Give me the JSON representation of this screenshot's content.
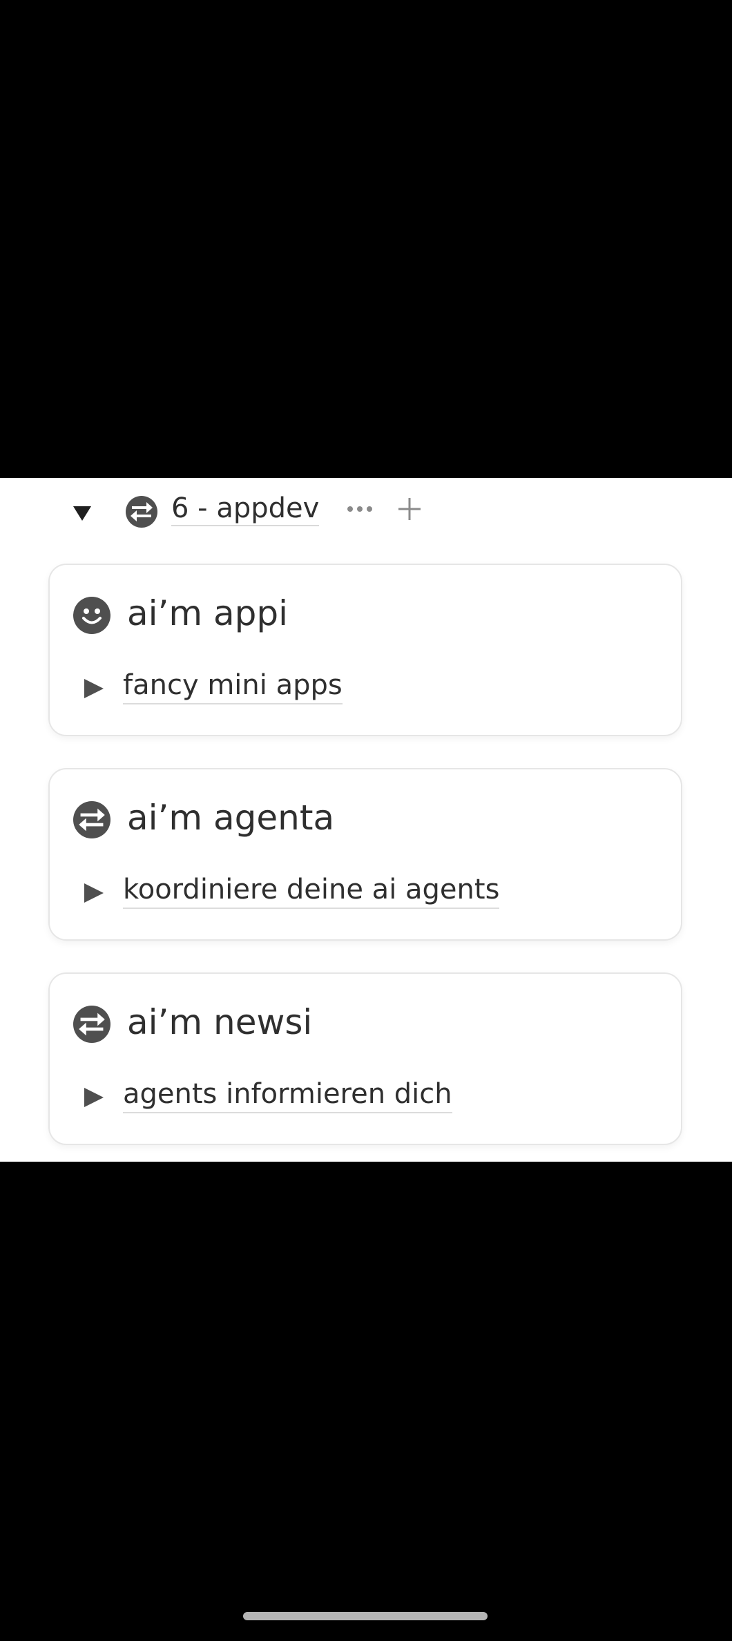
{
  "group": {
    "title": "6 - appdev",
    "toggle_icon": "caret-down-icon",
    "icon": "exchange-icon",
    "more_icon": "more-horizontal-icon",
    "add_icon": "plus-icon"
  },
  "cards": [
    {
      "title": "ai’m appi",
      "icon": "smiley-face-icon",
      "subitem": "fancy mini apps",
      "subitem_icon": "caret-right-icon"
    },
    {
      "title": "ai’m agenta",
      "icon": "exchange-icon",
      "subitem": "koordiniere deine ai agents",
      "subitem_icon": "caret-right-icon"
    },
    {
      "title": "ai’m newsi",
      "icon": "exchange-icon",
      "subitem": "agents informieren dich",
      "subitem_icon": "caret-right-icon"
    }
  ],
  "colors": {
    "icon": "#4f4f4f",
    "text": "#2f2f2f",
    "background_outside": "#000000",
    "panel": "#ffffff"
  }
}
